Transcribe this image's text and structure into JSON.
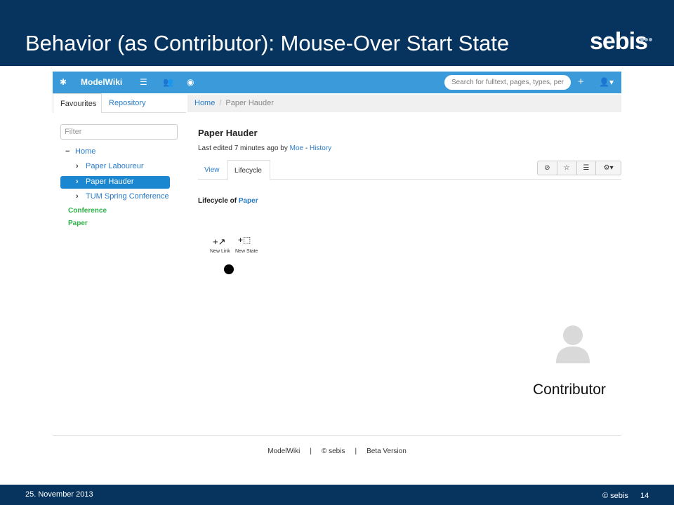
{
  "slide": {
    "title": "Behavior (as Contributor): Mouse-Over Start State",
    "logo": "sebis",
    "footer_date": "25. November 2013",
    "footer_copyright": "© sebis",
    "page_number": "14"
  },
  "app": {
    "navbar": {
      "brand": "ModelWiki",
      "search_placeholder": "Search for fulltext, pages, types, per"
    },
    "left_tabs": [
      "Favourites",
      "Repository"
    ],
    "breadcrumb": [
      "Home",
      "Paper Hauder"
    ],
    "filter_placeholder": "Filter",
    "tree": {
      "home": "Home",
      "children": [
        "Paper Laboureur",
        "Paper Hauder",
        "TUM Spring Conference"
      ],
      "selected": "Paper Hauder",
      "types": [
        "Conference",
        "Paper"
      ]
    },
    "page": {
      "title": "Paper Hauder",
      "meta_prefix": "Last edited 7 minutes ago by ",
      "meta_author": "Moe",
      "meta_sep": " - ",
      "meta_history": "History",
      "tabs": [
        "View",
        "Lifecycle"
      ],
      "active_tab": "Lifecycle",
      "lifecycle_prefix": "Lifecycle of ",
      "lifecycle_type": "Paper",
      "tools": [
        "New Link",
        "New State"
      ]
    },
    "footer": [
      "ModelWiki",
      "|",
      "© sebis",
      "|",
      "Beta Version"
    ]
  },
  "persona": {
    "label": "Contributor"
  },
  "colors": {
    "slide_header": "#07345e",
    "navbar": "#3b9ad9",
    "link": "#2a7cc7",
    "selected": "#1a87d0",
    "type_label": "#2eb24a"
  }
}
